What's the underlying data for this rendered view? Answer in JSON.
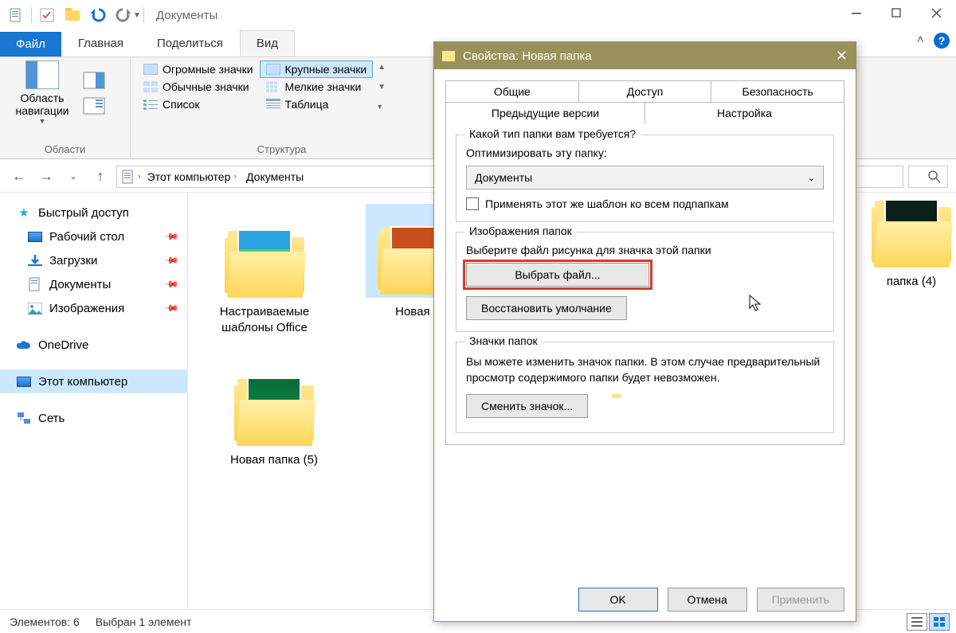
{
  "window": {
    "title": "Документы",
    "min": "—",
    "max": "□",
    "close": "✕"
  },
  "tabs": {
    "file": "Файл",
    "home": "Главная",
    "share": "Поделиться",
    "view": "Вид",
    "expand": "˄"
  },
  "ribbon": {
    "nav_pane": "Область навигации",
    "group_panels": "Области",
    "struct": {
      "huge_icons": "Огромные значки",
      "large_icons": "Крупные значки",
      "normal_icons": "Обычные значки",
      "small_icons": "Мелкие значки",
      "list": "Список",
      "table": "Таблица",
      "group_label": "Структура"
    }
  },
  "nav": {
    "this_pc": "Этот компьютер",
    "documents": "Документы"
  },
  "sidebar": {
    "quick": "Быстрый доступ",
    "desktop": "Рабочий стол",
    "downloads": "Загрузки",
    "documents": "Документы",
    "pictures": "Изображения",
    "onedrive": "OneDrive",
    "this_pc": "Этот компьютер",
    "network": "Сеть"
  },
  "files": {
    "f1": "Настраиваемые шаблоны Office",
    "f2": "Новая п",
    "f3": "Новая папка (5)",
    "f4": "папка (4)"
  },
  "status": {
    "count": "Элементов: 6",
    "selected": "Выбран 1 элемент"
  },
  "dialog": {
    "title": "Свойства: Новая папка",
    "tab_general": "Общие",
    "tab_sharing": "Доступ",
    "tab_security": "Безопасность",
    "tab_prev": "Предыдущие версии",
    "tab_customize": "Настройка",
    "g1_legend": "Какой тип папки вам требуется?",
    "g1_optimize": "Оптимизировать эту папку:",
    "dropdown_value": "Документы",
    "apply_all": "Применять этот же шаблон ко всем подпапкам",
    "g2_legend": "Изображения папок",
    "g2_text": "Выберите файл рисунка для значка этой папки",
    "choose_file": "Выбрать файл...",
    "restore_default": "Восстановить умолчание",
    "g3_legend": "Значки папок",
    "g3_text": "Вы можете изменить значок папки. В этом случае предварительный просмотр содержимого папки будет невозможен.",
    "change_icon": "Сменить значок...",
    "ok": "OK",
    "cancel": "Отмена",
    "apply": "Применить"
  }
}
